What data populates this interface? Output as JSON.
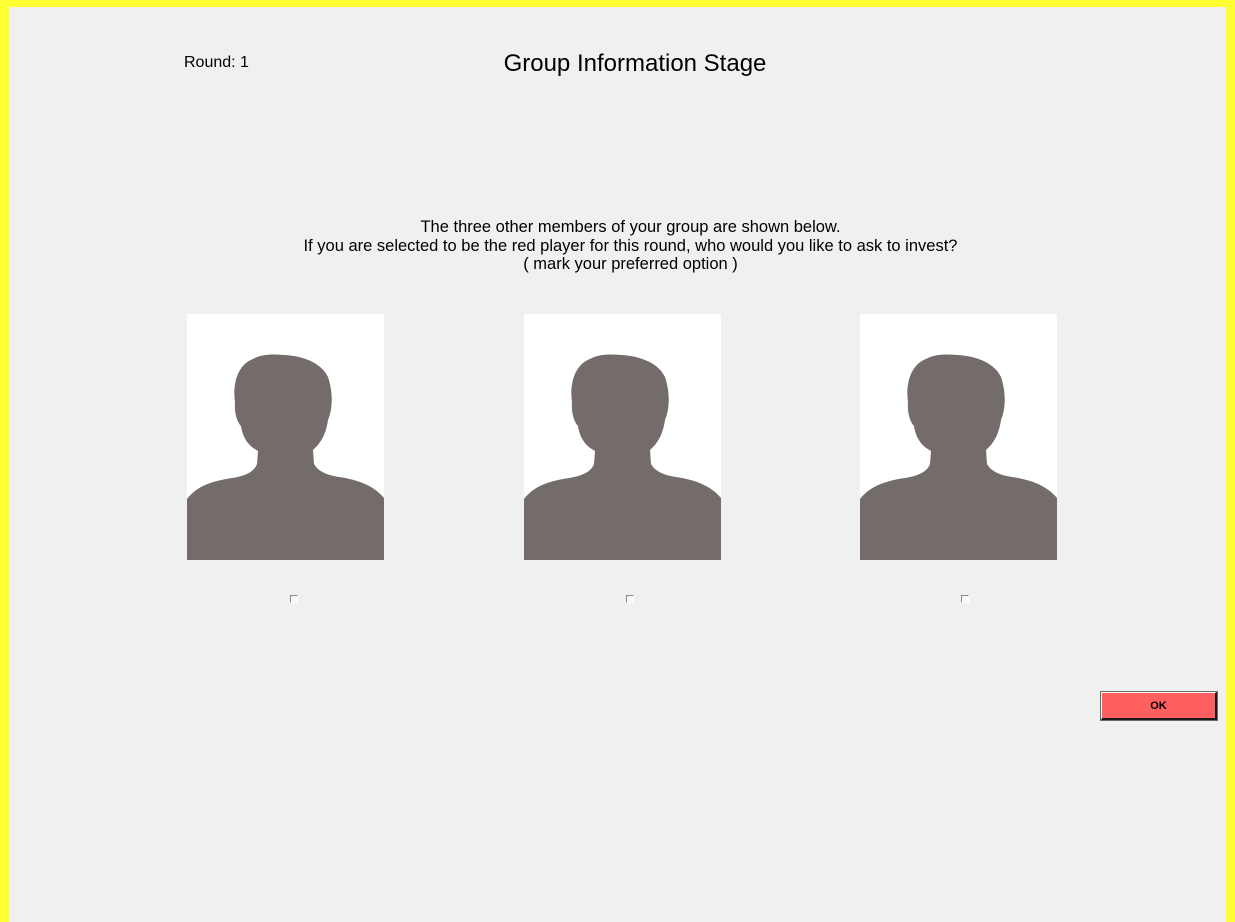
{
  "header": {
    "round_label": "Round: 1",
    "title": "Group Information Stage"
  },
  "instructions": {
    "line1": "The three other members of your group are shown below.",
    "line2": "If you are selected to be the red player for this round, who would you like to ask to invest?",
    "line3": "( mark your preferred option )"
  },
  "members": [
    {
      "photo_icon": "person-silhouette-icon",
      "checked": false
    },
    {
      "photo_icon": "person-silhouette-icon",
      "checked": false
    },
    {
      "photo_icon": "person-silhouette-icon",
      "checked": false
    }
  ],
  "actions": {
    "ok_label": "OK"
  },
  "colors": {
    "window_border": "#ffff33",
    "background": "#f0f0f0",
    "silhouette": "#736c6b",
    "ok_button": "#ff5f5f"
  }
}
